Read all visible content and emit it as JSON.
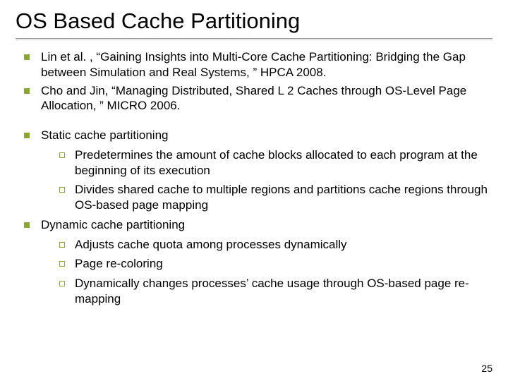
{
  "title": "OS Based Cache Partitioning",
  "refs": [
    "Lin et al. , “Gaining Insights into Multi-Core Cache Partitioning: Bridging the Gap between Simulation and Real Systems, ” HPCA 2008.",
    "Cho and Jin, “Managing Distributed, Shared L 2 Caches through OS-Level Page Allocation, ” MICRO 2006."
  ],
  "sections": [
    {
      "heading": "Static cache partitioning",
      "items": [
        "Predetermines the amount of cache blocks allocated to each program at the beginning of its execution",
        "Divides shared cache to multiple regions and partitions cache regions through OS-based page mapping"
      ]
    },
    {
      "heading": "Dynamic cache partitioning",
      "items": [
        "Adjusts cache quota among processes dynamically",
        "Page re-coloring",
        "Dynamically changes processes’ cache usage through OS-based page re-mapping"
      ]
    }
  ],
  "page_number": "25"
}
